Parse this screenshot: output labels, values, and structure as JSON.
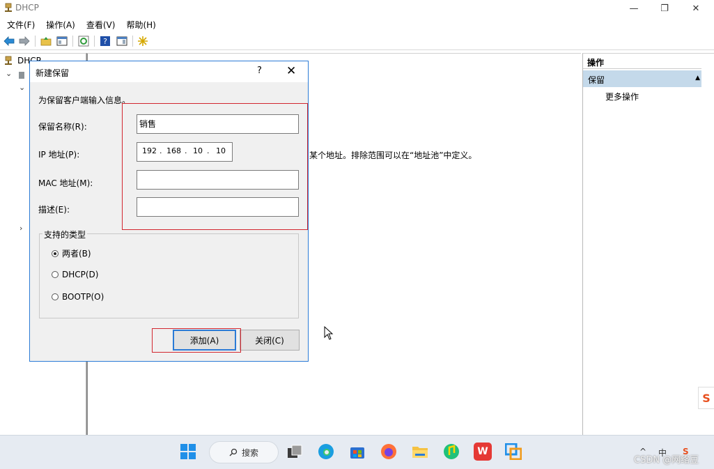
{
  "window": {
    "title": "DHCP",
    "minimize": "—",
    "maximize": "❐",
    "close": "✕"
  },
  "menu": [
    "文件(F)",
    "操作(A)",
    "查看(V)",
    "帮助(H)"
  ],
  "tree": {
    "root": "DHCP"
  },
  "center": {
    "text": "某个地址。排除范围可以在“地址池”中定义。"
  },
  "actions": {
    "header": "操作",
    "section": "保留",
    "item": "更多操作"
  },
  "dialog": {
    "title": "新建保留",
    "help": "?",
    "close": "✕",
    "intro": "为保留客户端输入信息。",
    "name_label": "保留名称(R):",
    "name_value": "销售",
    "ip_label": "IP 地址(P):",
    "ip": [
      "192",
      "168",
      "10",
      "10"
    ],
    "mac_label": "MAC 地址(M):",
    "mac_value": "",
    "desc_label": "描述(E):",
    "desc_value": "",
    "group_title": "支持的类型",
    "options": [
      "两者(B)",
      "DHCP(D)",
      "BOOTP(O)"
    ],
    "selected_option": "两者(B)",
    "add_button": "添加(A)",
    "close_button": "关闭(C)"
  },
  "taskbar": {
    "search_label": "搜索",
    "ime": "中",
    "tray_chevron": "^"
  },
  "watermark": "CSDN @网络豆",
  "colors": {
    "accent": "#2b7bd6",
    "highlight": "#d2262f",
    "actions_section_bg": "#c4d9ea"
  }
}
